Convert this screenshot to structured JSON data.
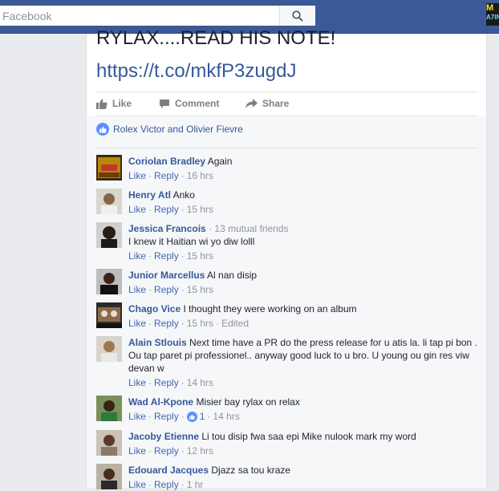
{
  "topbar": {
    "search_placeholder": "Facebook",
    "badge_top": "M",
    "badge_bottom": "A7IN"
  },
  "post": {
    "text_line": "RYLAX....READ HIS NOTE!",
    "link": "https://t.co/mkfP3zugdJ"
  },
  "actions": {
    "like": "Like",
    "comment": "Comment",
    "share": "Share"
  },
  "likes": {
    "text": "Rolex Victor and Olivier Fievre"
  },
  "comments": [
    {
      "name": "Coriolan Bradley",
      "text": "Again",
      "like": "Like",
      "reply": "Reply",
      "time": "16 hrs"
    },
    {
      "name": "Henry Atl",
      "text": "Anko",
      "like": "Like",
      "reply": "Reply",
      "time": "15 hrs"
    },
    {
      "name": "Jessica Francois",
      "mutual": "13 mutual friends",
      "text": "I knew it Haitian wi yo diw lolll",
      "like": "Like",
      "reply": "Reply",
      "time": "15 hrs"
    },
    {
      "name": "Junior Marcellus",
      "text": "Al nan disip",
      "like": "Like",
      "reply": "Reply",
      "time": "15 hrs"
    },
    {
      "name": "Chago Vice",
      "text": "I thought they were working on an album",
      "like": "Like",
      "reply": "Reply",
      "time": "15 hrs",
      "edited": "Edited"
    },
    {
      "name": "Alain Stlouis",
      "text": "Next time have a PR do the press release for u atis la. li tap pi bon . Ou tap paret pi professionel.. anyway good luck to u bro. U young ou gin res viw devan w",
      "like": "Like",
      "reply": "Reply",
      "time": "14 hrs"
    },
    {
      "name": "Wad Al-Kpone",
      "text": "Misier bay rylax on relax",
      "like": "Like",
      "reply": "Reply",
      "reactions": "1",
      "time": "14 hrs"
    },
    {
      "name": "Jacoby Etienne",
      "text": "Li tou disip fwa saa epi Mike nulook mark my word",
      "like": "Like",
      "reply": "Reply",
      "time": "12 hrs"
    },
    {
      "name": "Edouard Jacques",
      "text": "Djazz sa tou kraze",
      "like": "Like",
      "reply": "Reply",
      "time": "1 hr"
    }
  ]
}
